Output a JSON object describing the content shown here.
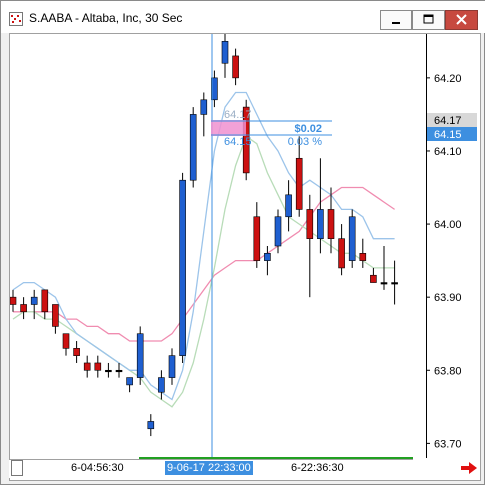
{
  "window": {
    "title": "S.AABA - Altaba, Inc, 30 Sec"
  },
  "icons": {
    "app": "chart-app-icon",
    "minimize": "minimize-icon",
    "maximize": "maximize-icon",
    "close": "close-icon",
    "scroll_forward": "red-right-arrow-icon"
  },
  "colors": {
    "candle_up": "#1f5fd0",
    "candle_down": "#cc1111",
    "ma_fast": "#9cc4ea",
    "ma_mid": "#b8dcb8",
    "ma_slow": "#f08cb0",
    "crosshair": "#3d8fe0",
    "highlight_box": "#f090d0",
    "last_price_tag": "#3d8fe0"
  },
  "price_axis": {
    "ticks": [
      "64.20",
      "64.10",
      "64.00",
      "63.90",
      "63.80",
      "63.70"
    ],
    "last_price_top": "64.17",
    "last_price_bottom": "64.15"
  },
  "measure_tool": {
    "price_faint": "64.17",
    "price_main": "64.15",
    "change_value": "$0.02",
    "change_percent": "0.03 %"
  },
  "time_axis": {
    "labels": [
      "6-04:56:30",
      "9-06-17 22:33:00",
      "6-22:36:30"
    ],
    "highlighted_label": "9-06-17 22:33:00"
  },
  "chart_data": {
    "type": "candlestick",
    "title": "S.AABA - Altaba, Inc, 30 Sec",
    "ylim": [
      63.68,
      64.26
    ],
    "y_ticks": [
      64.2,
      64.1,
      64.0,
      63.9,
      63.8,
      63.7
    ],
    "last_price": [
      64.17,
      64.15
    ],
    "candles": [
      {
        "o": 63.9,
        "h": 63.91,
        "l": 63.88,
        "c": 63.89,
        "dir": "down"
      },
      {
        "o": 63.89,
        "h": 63.9,
        "l": 63.87,
        "c": 63.88,
        "dir": "down"
      },
      {
        "o": 63.89,
        "h": 63.91,
        "l": 63.87,
        "c": 63.9,
        "dir": "up"
      },
      {
        "o": 63.91,
        "h": 63.91,
        "l": 63.87,
        "c": 63.88,
        "dir": "down"
      },
      {
        "o": 63.89,
        "h": 63.89,
        "l": 63.85,
        "c": 63.86,
        "dir": "down"
      },
      {
        "o": 63.85,
        "h": 63.85,
        "l": 63.82,
        "c": 63.83,
        "dir": "down"
      },
      {
        "o": 63.83,
        "h": 63.84,
        "l": 63.81,
        "c": 63.82,
        "dir": "down"
      },
      {
        "o": 63.81,
        "h": 63.82,
        "l": 63.79,
        "c": 63.8,
        "dir": "down"
      },
      {
        "o": 63.81,
        "h": 63.82,
        "l": 63.79,
        "c": 63.8,
        "dir": "down"
      },
      {
        "o": 63.8,
        "h": 63.81,
        "l": 63.79,
        "c": 63.8,
        "dir": "flat"
      },
      {
        "o": 63.8,
        "h": 63.81,
        "l": 63.79,
        "c": 63.8,
        "dir": "flat"
      },
      {
        "o": 63.78,
        "h": 63.79,
        "l": 63.77,
        "c": 63.79,
        "dir": "up"
      },
      {
        "o": 63.79,
        "h": 63.86,
        "l": 63.78,
        "c": 63.85,
        "dir": "up"
      },
      {
        "o": 63.72,
        "h": 63.74,
        "l": 63.71,
        "c": 63.73,
        "dir": "up"
      },
      {
        "o": 63.77,
        "h": 63.8,
        "l": 63.76,
        "c": 63.79,
        "dir": "up"
      },
      {
        "o": 63.79,
        "h": 63.83,
        "l": 63.78,
        "c": 63.82,
        "dir": "up"
      },
      {
        "o": 63.82,
        "h": 64.07,
        "l": 63.81,
        "c": 64.06,
        "dir": "up"
      },
      {
        "o": 64.06,
        "h": 64.16,
        "l": 64.05,
        "c": 64.15,
        "dir": "up"
      },
      {
        "o": 64.15,
        "h": 64.18,
        "l": 64.12,
        "c": 64.17,
        "dir": "up"
      },
      {
        "o": 64.17,
        "h": 64.21,
        "l": 64.16,
        "c": 64.2,
        "dir": "up"
      },
      {
        "o": 64.22,
        "h": 64.26,
        "l": 64.2,
        "c": 64.25,
        "dir": "up"
      },
      {
        "o": 64.23,
        "h": 64.24,
        "l": 64.19,
        "c": 64.2,
        "dir": "down"
      },
      {
        "o": 64.16,
        "h": 64.17,
        "l": 64.06,
        "c": 64.07,
        "dir": "down"
      },
      {
        "o": 64.01,
        "h": 64.03,
        "l": 63.94,
        "c": 63.95,
        "dir": "down"
      },
      {
        "o": 63.95,
        "h": 63.97,
        "l": 63.93,
        "c": 63.96,
        "dir": "up"
      },
      {
        "o": 63.97,
        "h": 64.02,
        "l": 63.96,
        "c": 64.01,
        "dir": "up"
      },
      {
        "o": 64.01,
        "h": 64.06,
        "l": 63.99,
        "c": 64.04,
        "dir": "up"
      },
      {
        "o": 64.09,
        "h": 64.12,
        "l": 64.01,
        "c": 64.02,
        "dir": "down"
      },
      {
        "o": 64.02,
        "h": 64.04,
        "l": 63.9,
        "c": 63.98,
        "dir": "down"
      },
      {
        "o": 63.98,
        "h": 64.09,
        "l": 63.96,
        "c": 64.02,
        "dir": "up"
      },
      {
        "o": 64.02,
        "h": 64.05,
        "l": 63.96,
        "c": 63.98,
        "dir": "down"
      },
      {
        "o": 63.98,
        "h": 64.0,
        "l": 63.93,
        "c": 63.94,
        "dir": "down"
      },
      {
        "o": 63.95,
        "h": 64.02,
        "l": 63.94,
        "c": 64.01,
        "dir": "up"
      },
      {
        "o": 63.95,
        "h": 63.98,
        "l": 63.94,
        "c": 63.96,
        "dir": "down"
      },
      {
        "o": 63.93,
        "h": 63.94,
        "l": 63.92,
        "c": 63.92,
        "dir": "down"
      },
      {
        "o": 63.92,
        "h": 63.97,
        "l": 63.91,
        "c": 63.92,
        "dir": "flat"
      },
      {
        "o": 63.92,
        "h": 63.95,
        "l": 63.89,
        "c": 63.92,
        "dir": "flat"
      }
    ],
    "ma_fast": [
      63.91,
      63.92,
      63.92,
      63.91,
      63.9,
      63.87,
      63.85,
      63.84,
      63.83,
      63.82,
      63.81,
      63.8,
      63.8,
      63.78,
      63.77,
      63.76,
      63.8,
      63.88,
      63.99,
      64.1,
      64.16,
      64.18,
      64.18,
      64.15,
      64.12,
      64.1,
      64.07,
      64.05,
      64.06,
      64.05,
      64.04,
      64.02,
      64.02,
      64.01,
      63.98,
      63.98,
      63.98
    ],
    "ma_mid": [
      63.87,
      63.88,
      63.88,
      63.87,
      63.87,
      63.86,
      63.85,
      63.84,
      63.83,
      63.82,
      63.81,
      63.8,
      63.79,
      63.77,
      63.76,
      63.75,
      63.77,
      63.81,
      63.87,
      63.94,
      64.02,
      64.08,
      64.12,
      64.11,
      64.07,
      64.04,
      64.01,
      64.0,
      63.99,
      63.98,
      63.97,
      63.96,
      63.96,
      63.95,
      63.94,
      63.94,
      63.94
    ],
    "ma_slow": [
      63.88,
      63.88,
      63.88,
      63.88,
      63.88,
      63.87,
      63.87,
      63.86,
      63.86,
      63.85,
      63.85,
      63.84,
      63.84,
      63.84,
      63.84,
      63.85,
      63.87,
      63.89,
      63.91,
      63.93,
      63.94,
      63.95,
      63.95,
      63.95,
      63.96,
      63.97,
      63.98,
      63.99,
      64.01,
      64.03,
      64.04,
      64.05,
      64.05,
      64.05,
      64.04,
      64.03,
      64.02
    ]
  }
}
